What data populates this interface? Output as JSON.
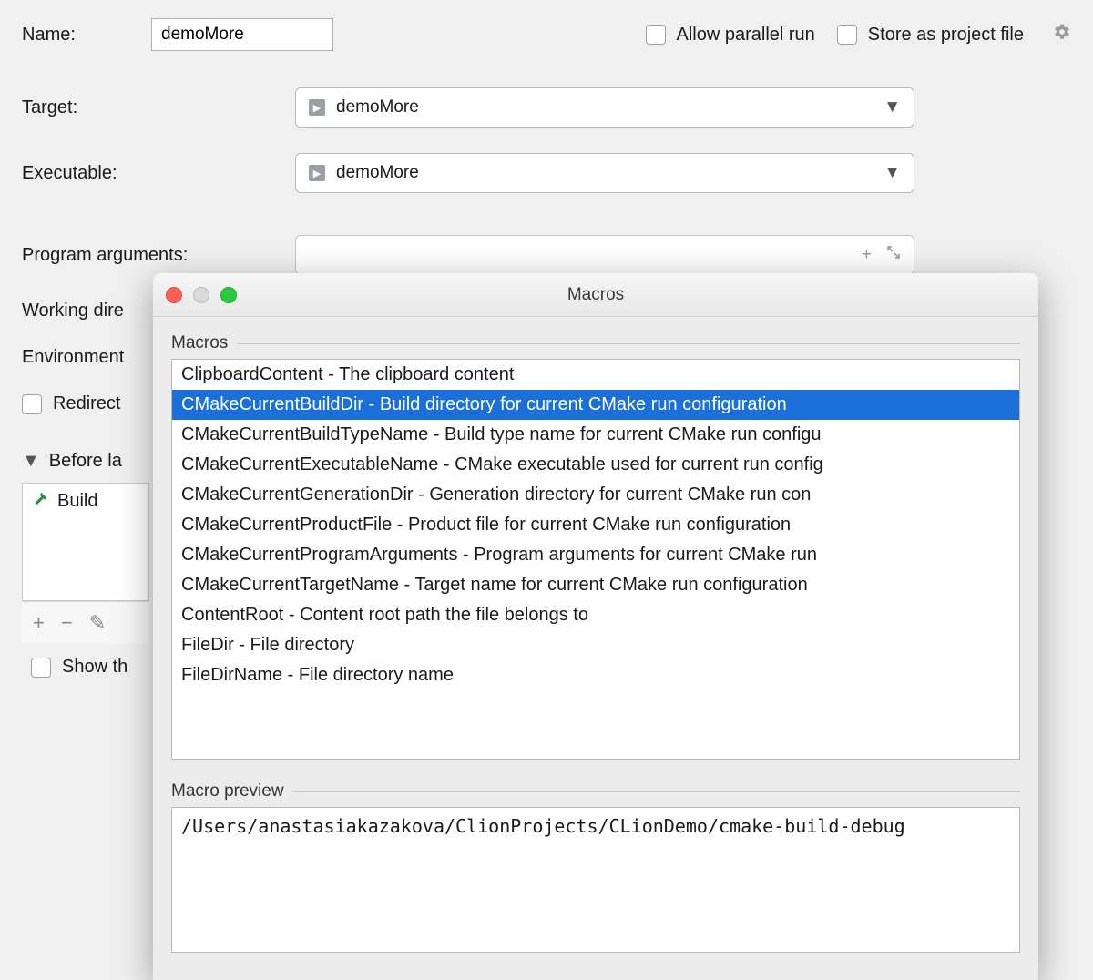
{
  "form": {
    "name_label": "Name:",
    "name_value": "demoMore",
    "allow_parallel": "Allow parallel run",
    "store_project": "Store as project file",
    "target_label": "Target:",
    "target_value": "demoMore",
    "exec_label": "Executable:",
    "exec_value": "demoMore",
    "args_label": "Program arguments:",
    "workdir_label": "Working dire",
    "env_label": "Environment",
    "redirect_label": "Redirect",
    "before_launch_label": "Before la",
    "build_item": "Build",
    "show_this": "Show th"
  },
  "dialog": {
    "title": "Macros",
    "list_label": "Macros",
    "preview_label": "Macro preview",
    "preview_value": "/Users/anastasiakazakova/ClionProjects/CLionDemo/cmake-build-debug",
    "items": [
      "ClipboardContent - The clipboard content",
      "CMakeCurrentBuildDir - Build directory for current CMake run configuration",
      "CMakeCurrentBuildTypeName - Build type name for current CMake run configu",
      "CMakeCurrentExecutableName - CMake executable used for current run config",
      "CMakeCurrentGenerationDir - Generation directory for current CMake run con",
      "CMakeCurrentProductFile - Product file for current CMake run configuration",
      "CMakeCurrentProgramArguments - Program arguments for current CMake run",
      "CMakeCurrentTargetName - Target name for current CMake run configuration",
      "ContentRoot - Content root path the file belongs to",
      "FileDir - File directory",
      "FileDirName - File directory name"
    ],
    "selected_index": 1
  }
}
